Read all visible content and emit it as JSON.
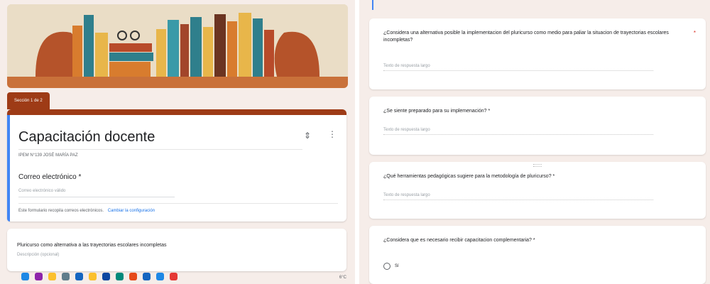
{
  "left": {
    "section_tab": "Sección 1 de 2",
    "form_title": "Capacitación docente",
    "school": "IPEM N°139 JOSÉ MARÍA PAZ",
    "email_label": "Correo electrónico *",
    "email_placeholder": "Correo electrónico válido",
    "collect_note": "Este formulario recopila correos electrónicos.",
    "collect_link": "Cambiar la configuración",
    "section_title": "Pluricurso como alternativa a las trayectorias escolares incompletas",
    "section_desc": "Descripción (opcional)",
    "tray_text": "6°C"
  },
  "right": {
    "questions": [
      {
        "text": "¿Considera una alternativa posible la implementacion del pluricurso como medio para paliar la situacion de trayectorias escolares incompletas?",
        "answer": "Texto de respuesta largo"
      },
      {
        "text": "¿Se siente preparado para su implemenación? *",
        "answer": "Texto de respuesta largo"
      },
      {
        "text": "¿Qué herramientas pedagógicas sugiere para la metodología de pluricurso? *",
        "answer": "Texto de respuesta largo"
      },
      {
        "text": "¿Considera que es necesario recibir capacitacion complementaria? *",
        "option": "Sí"
      }
    ],
    "required_star": "*"
  },
  "taskbar_icons": [
    {
      "name": "windows-start-icon",
      "color": "#1e88e5"
    },
    {
      "name": "search-icon",
      "color": "#8e24aa"
    },
    {
      "name": "cortana-icon",
      "color": "#fbc02d"
    },
    {
      "name": "task-view-icon",
      "color": "#607d8b"
    },
    {
      "name": "edge-icon",
      "color": "#1565c0"
    },
    {
      "name": "file-explorer-icon",
      "color": "#fbc02d"
    },
    {
      "name": "store-icon",
      "color": "#0d47a1"
    },
    {
      "name": "photos-icon",
      "color": "#00897b"
    },
    {
      "name": "office-icon",
      "color": "#e64a19"
    },
    {
      "name": "outlook-icon",
      "color": "#1565c0"
    },
    {
      "name": "teams-icon",
      "color": "#1e88e5"
    },
    {
      "name": "chrome-icon",
      "color": "#e53935"
    }
  ]
}
